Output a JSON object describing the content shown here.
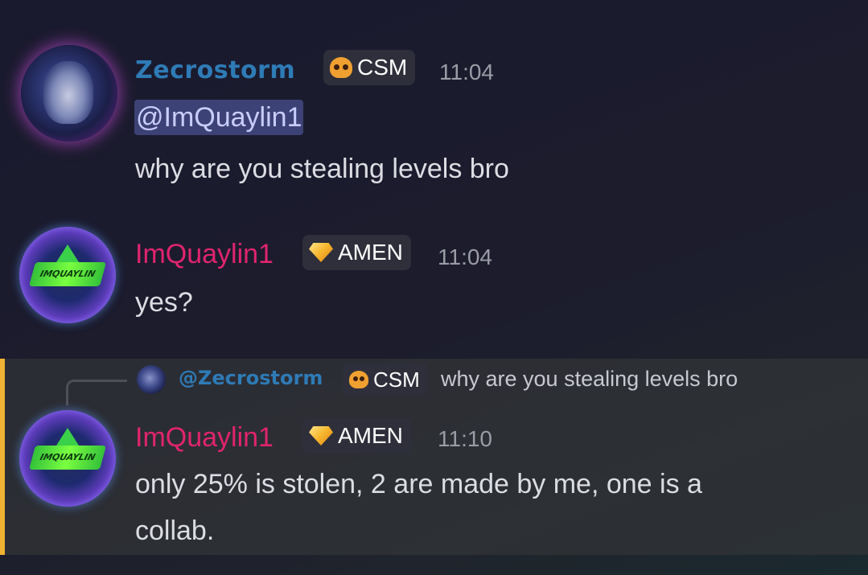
{
  "messages": [
    {
      "author": "Zecrostorm",
      "tag": "CSM",
      "tag_icon": "skull-icon",
      "time": "11:04",
      "mention": "@ImQuaylin1",
      "text": "why are you stealing levels bro",
      "name_color": "#2e7bb6"
    },
    {
      "author": "ImQuaylin1",
      "tag": "AMEN",
      "tag_icon": "gem-icon",
      "time": "11:04",
      "text": "yes?",
      "name_color": "#e0246e"
    },
    {
      "author": "ImQuaylin1",
      "tag": "AMEN",
      "tag_icon": "gem-icon",
      "time": "11:10",
      "text_line1": "only 25% is stolen, 2 are made by me, one is a",
      "text_line2": "collab.",
      "name_color": "#e0246e",
      "highlighted": true,
      "reply": {
        "author": "@Zecrostorm",
        "tag": "CSM",
        "text": "why are you stealing levels bro"
      }
    }
  ],
  "avatar_logo_text": "IMQUAYLIN",
  "colors": {
    "highlight_bar": "#f0b232",
    "mention_bg": "#3d4276",
    "mention_text": "#c9cdfb"
  }
}
